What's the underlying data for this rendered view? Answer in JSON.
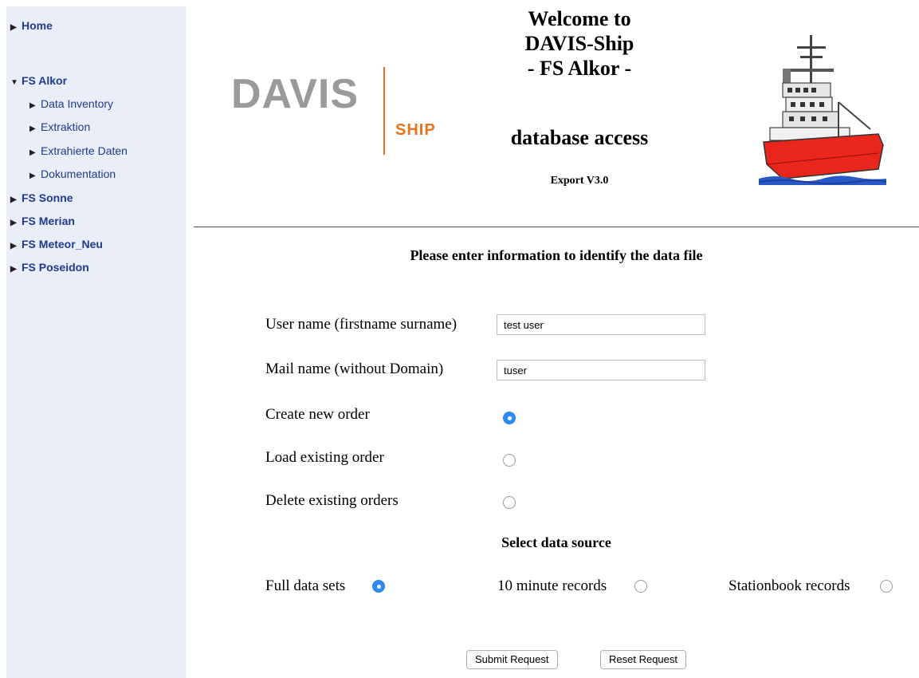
{
  "sidebar": {
    "items": [
      {
        "label": "Home"
      },
      {
        "label": "FS Alkor"
      },
      {
        "label": "Data Inventory"
      },
      {
        "label": "Extraktion"
      },
      {
        "label": "Extrahierte Daten"
      },
      {
        "label": "Dokumentation"
      },
      {
        "label": "FS Sonne"
      },
      {
        "label": "FS Merian"
      },
      {
        "label": "FS Meteor_Neu"
      },
      {
        "label": "FS Poseidon"
      }
    ]
  },
  "header": {
    "logo_main": "DAVIS",
    "logo_sub": "SHIP",
    "welcome_line1": "Welcome to",
    "welcome_line2": "DAVIS-Ship",
    "welcome_line3": "- FS Alkor -",
    "subtitle": "database access",
    "version": "Export V3.0"
  },
  "form": {
    "heading": "Please enter information to identify the data file",
    "user_label": "User name (firstname surname)",
    "user_value": "test user",
    "mail_label": "Mail name (without Domain)",
    "mail_value": "tuser",
    "order_options": [
      {
        "label": "Create new order",
        "selected": true
      },
      {
        "label": "Load existing order",
        "selected": false
      },
      {
        "label": "Delete existing orders",
        "selected": false
      }
    ],
    "source_heading": "Select data source",
    "source_options": [
      {
        "label": "Full data sets",
        "selected": true
      },
      {
        "label": "10 minute records",
        "selected": false
      },
      {
        "label": "Stationbook records",
        "selected": false
      }
    ],
    "submit_label": "Submit Request",
    "reset_label": "Reset Request"
  },
  "colors": {
    "sidebar_bg": "#eaeef9",
    "link": "#1f3a8f",
    "logo_accent": "#e8731f",
    "radio_selected": "#2f8bf5",
    "ship_hull": "#e8261c"
  }
}
